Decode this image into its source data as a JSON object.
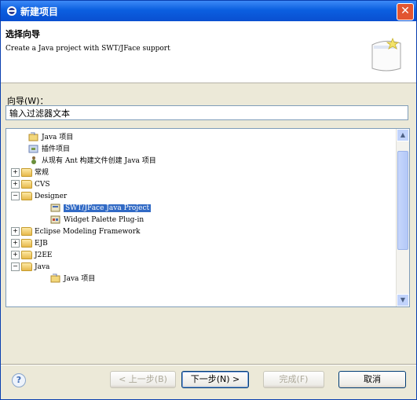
{
  "window": {
    "title": "新建项目"
  },
  "banner": {
    "title": "选择向导",
    "description": "Create a Java project with SWT/JFace support"
  },
  "filter": {
    "label": "向导(W)：",
    "value": "输入过滤器文本"
  },
  "tree": {
    "items": [
      {
        "label": "Java 项目"
      },
      {
        "label": "插件项目"
      },
      {
        "label": "从现有 Ant 构建文件创建 Java 项目"
      },
      {
        "label": "常规"
      },
      {
        "label": "CVS"
      },
      {
        "label": "Designer"
      },
      {
        "label": "SWT/JFace Java Project"
      },
      {
        "label": "Widget Palette Plug-in"
      },
      {
        "label": "Eclipse Modeling Framework"
      },
      {
        "label": "EJB"
      },
      {
        "label": "J2EE"
      },
      {
        "label": "Java"
      },
      {
        "label": "Java 项目"
      }
    ]
  },
  "buttons": {
    "back": "< 上一步(B)",
    "next": "下一步(N) >",
    "finish": "完成(F)",
    "cancel": "取消"
  },
  "colors": {
    "selection": "#316ac5",
    "titlebar": "#0b5fe0"
  }
}
